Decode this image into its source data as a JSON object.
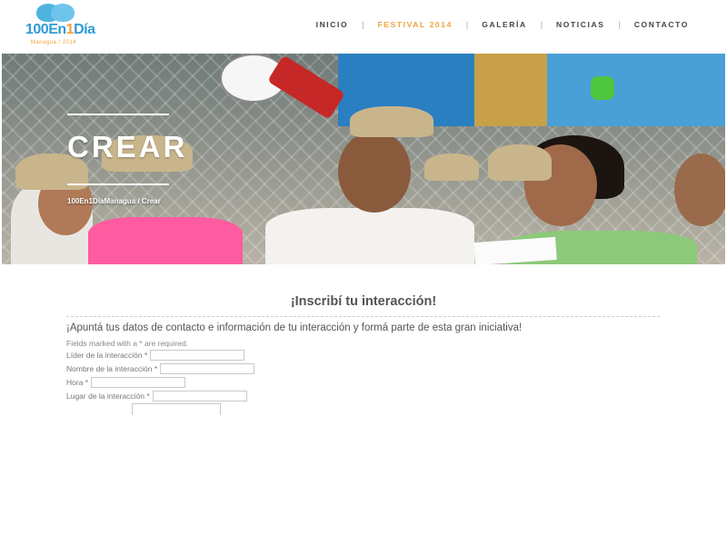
{
  "header": {
    "logo_main_a": "100",
    "logo_main_b": "En",
    "logo_main_c": "1",
    "logo_main_d": "Día",
    "logo_sub": "Managua / 2014",
    "nav": [
      {
        "label": "INICIO",
        "active": false
      },
      {
        "label": "FESTIVAL 2014",
        "active": true
      },
      {
        "label": "GALERÍA",
        "active": false
      },
      {
        "label": "NOTICIAS",
        "active": false
      },
      {
        "label": "CONTACTO",
        "active": false
      }
    ],
    "nav_separator": "|"
  },
  "hero": {
    "title": "CREAR",
    "breadcrumb": "100En1DíaManagua / Crear"
  },
  "form": {
    "title": "¡Inscribí tu interacción!",
    "intro": "¡Apuntá tus datos de contacto e información de tu interacción y formá parte de esta gran iniciativa!",
    "fields_note": "Fields marked with a * are required.",
    "fields": [
      {
        "label": "Líder de la interacción *",
        "value": ""
      },
      {
        "label": "Nombre de la interacción *",
        "value": ""
      },
      {
        "label": "Hora *",
        "value": ""
      },
      {
        "label": "Lugar de la interacción *",
        "value": ""
      }
    ]
  },
  "colors": {
    "accent": "#f0a33b",
    "logo_blue": "#2e9bd6",
    "text": "#555555"
  }
}
